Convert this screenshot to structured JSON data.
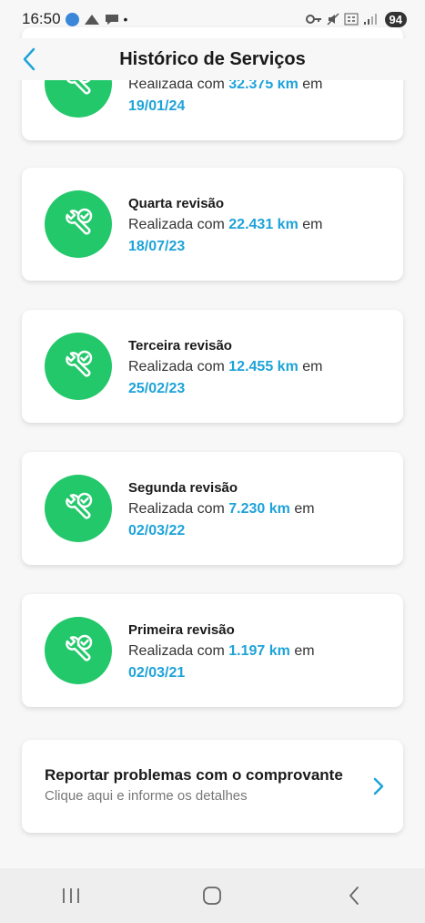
{
  "status_bar": {
    "time": "16:50",
    "battery": "94"
  },
  "header": {
    "title": "Histórico de Serviços"
  },
  "services": [
    {
      "title": "",
      "line_prefix": "Realizada com",
      "km": "32.375 km",
      "line_suffix": "em",
      "date": "19/01/24"
    },
    {
      "title": "Quarta revisão",
      "line_prefix": "Realizada com",
      "km": "22.431 km",
      "line_suffix": "em",
      "date": "18/07/23"
    },
    {
      "title": "Terceira revisão",
      "line_prefix": "Realizada com",
      "km": "12.455 km",
      "line_suffix": "em",
      "date": "25/02/23"
    },
    {
      "title": "Segunda revisão",
      "line_prefix": "Realizada com",
      "km": "7.230 km",
      "line_suffix": "em",
      "date": "02/03/22"
    },
    {
      "title": "Primeira revisão",
      "line_prefix": "Realizada com",
      "km": "1.197 km",
      "line_suffix": "em",
      "date": "02/03/21"
    }
  ],
  "report": {
    "title": "Reportar problemas com o comprovante",
    "subtitle": "Clique aqui e informe os detalhes"
  },
  "icons": {
    "service": "wrench-check-icon",
    "back": "back-arrow-icon",
    "report": "chevron-right-icon"
  },
  "colors": {
    "accent": "#1ea3d8",
    "service_icon_bg": "#22c86a",
    "background": "#f7f7f7"
  }
}
